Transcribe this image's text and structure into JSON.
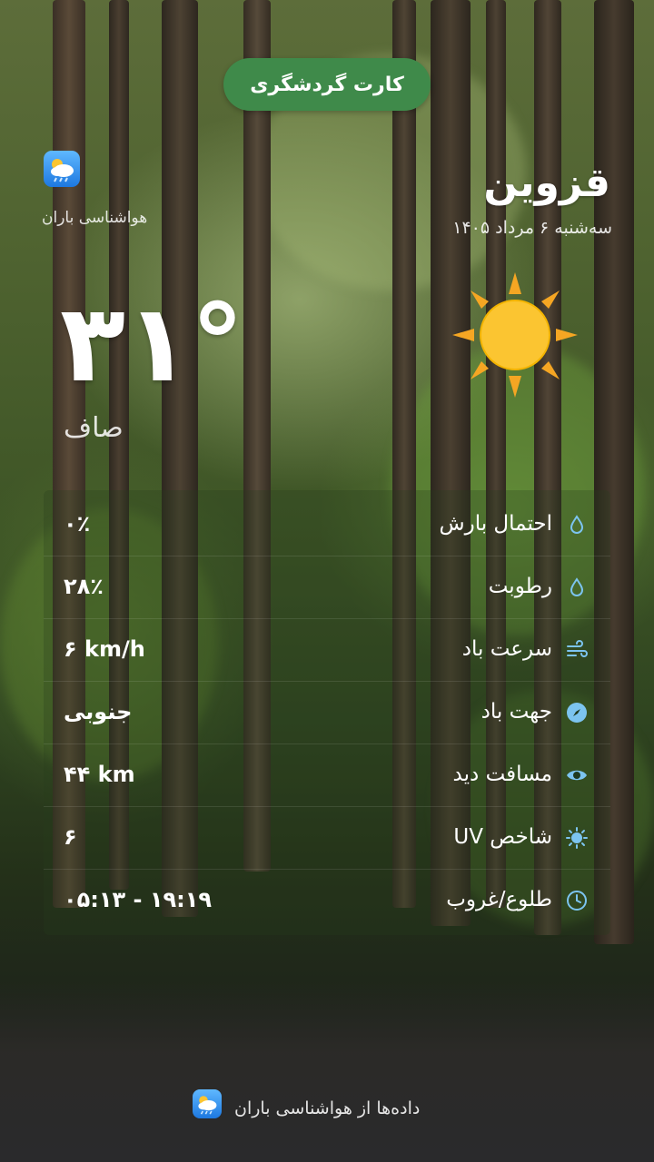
{
  "header": {
    "card_button_label": "کارت گردشگری"
  },
  "brand": {
    "name": "هواشناسی باران",
    "icon": "rain-cloud-app-icon"
  },
  "location": {
    "city": "قزوین",
    "date": "سه‌شنبه ۶ مرداد ۱۴۰۵"
  },
  "current": {
    "temperature": "۳۱°",
    "condition": "صاف",
    "icon": "sun-icon"
  },
  "details": [
    {
      "label": "احتمال بارش",
      "value": "۰٪",
      "icon": "droplet-icon"
    },
    {
      "label": "رطوبت",
      "value": "۲۸٪",
      "icon": "droplet-icon"
    },
    {
      "label": "سرعت باد",
      "value": "۶ km/h",
      "icon": "wind-icon"
    },
    {
      "label": "جهت باد",
      "value": "جنوبی",
      "icon": "compass-icon"
    },
    {
      "label": "مسافت دید",
      "value": "۴۴ km",
      "icon": "eye-icon"
    },
    {
      "label": "شاخص UV",
      "value": "۶",
      "icon": "sun-small-icon"
    },
    {
      "label": "طلوع/غروب",
      "value": "۰۵:۱۳ - ۱۹:۱۹",
      "icon": "clock-icon"
    }
  ],
  "footer": {
    "text": "داده‌ها از هواشناسی باران"
  },
  "colors": {
    "accent_green": "#3f8a4a",
    "icon_blue": "#7cc4f0",
    "sun_yellow": "#fbc531",
    "sun_ray": "#f5a623"
  }
}
